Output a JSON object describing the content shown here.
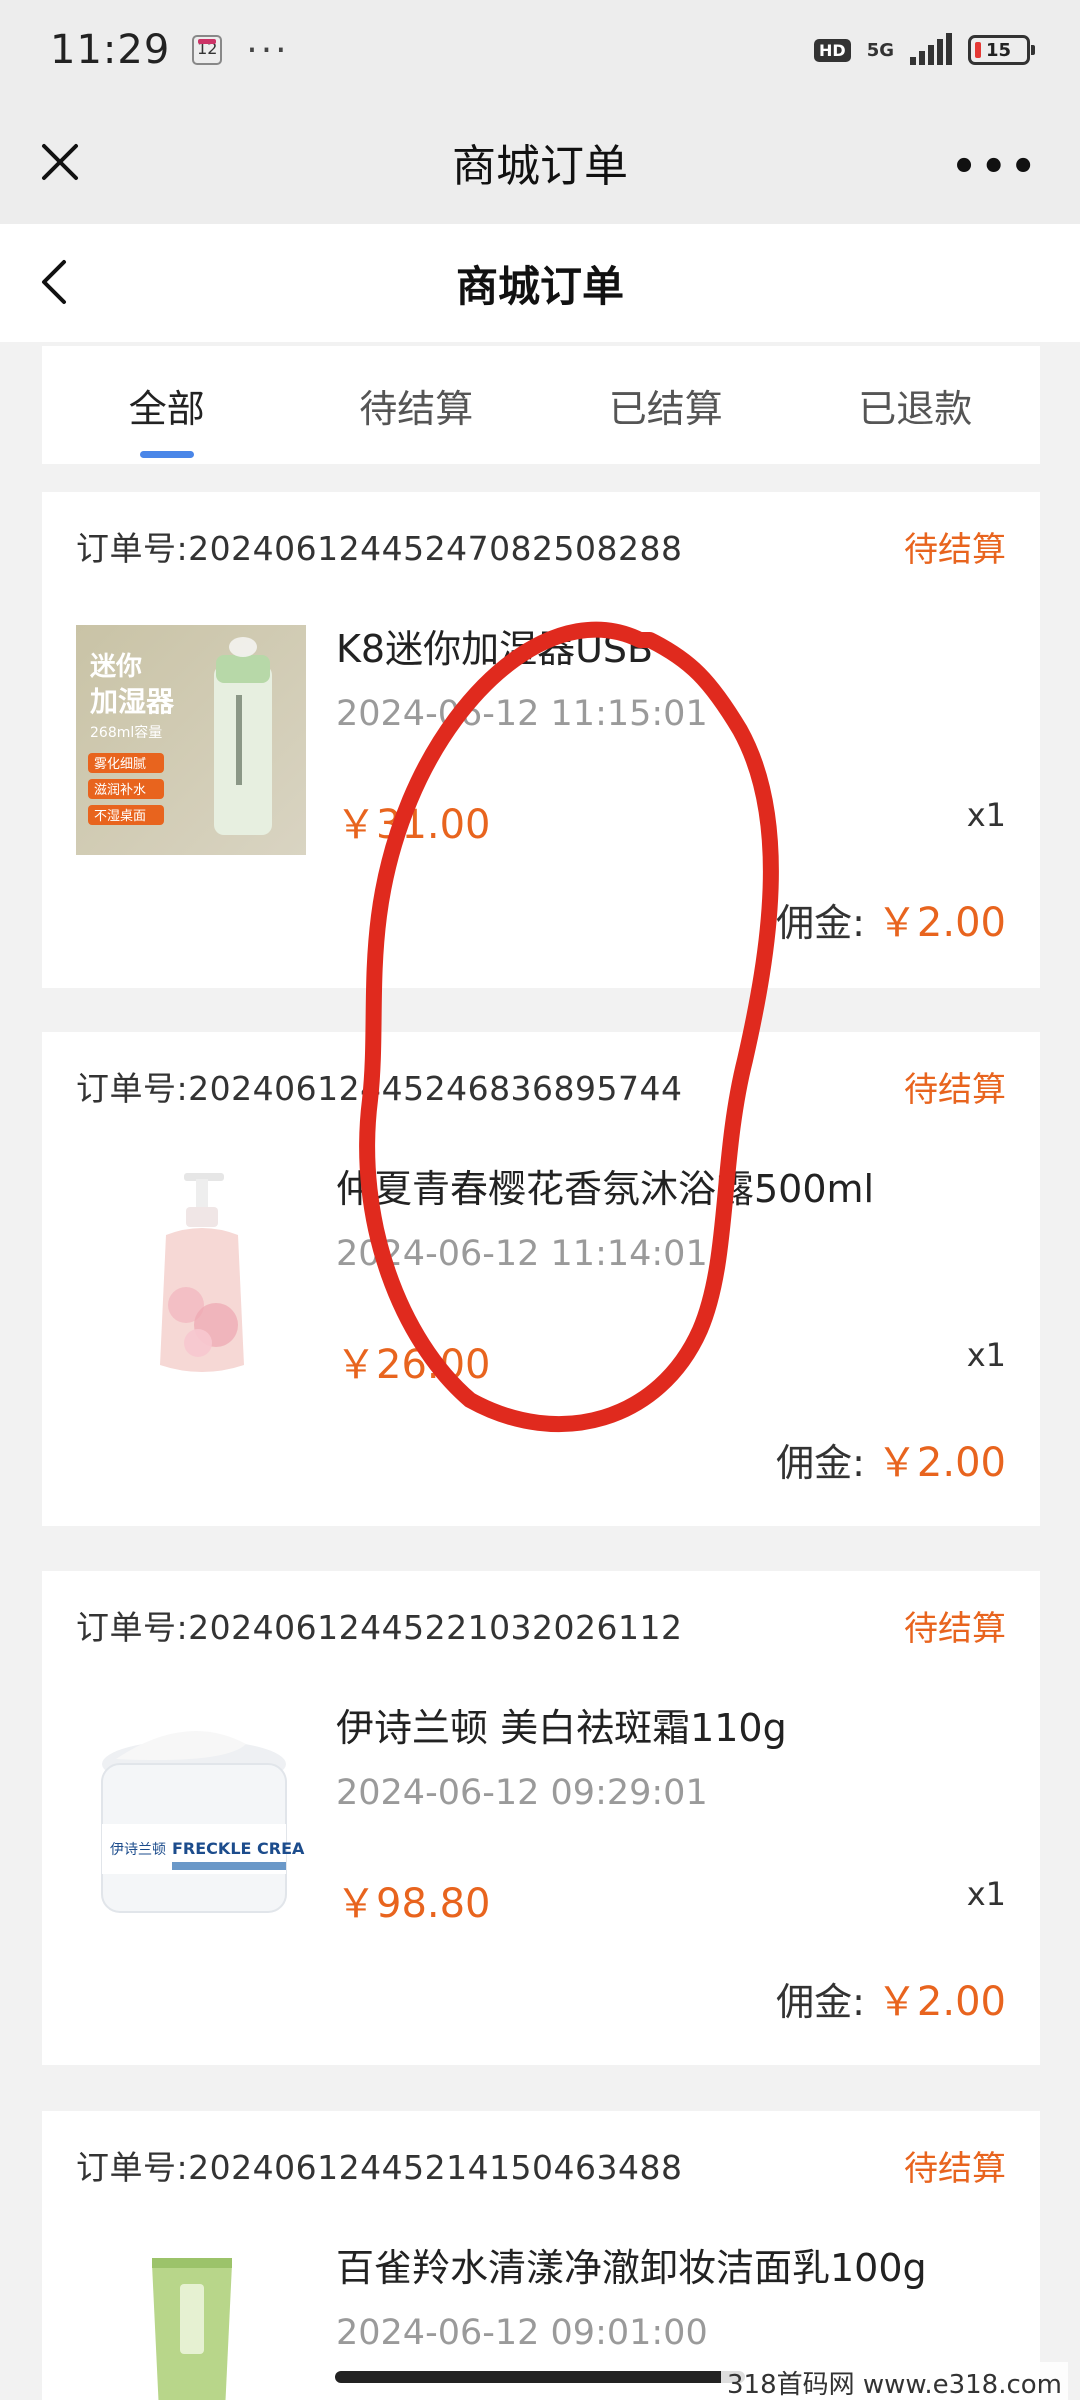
{
  "status_bar": {
    "time": "11:29",
    "calendar_day": "12",
    "more": "···",
    "hd": "HD",
    "network": "5G",
    "battery": "15",
    "battery_color": "#e53935"
  },
  "wechat_bar": {
    "title": "商城订单",
    "more": "•••",
    "close_icon": "close-icon"
  },
  "page_header": {
    "title": "商城订单",
    "back_icon": "chevron-left-icon"
  },
  "tabs": [
    {
      "label": "全部",
      "active": true
    },
    {
      "label": "待结算",
      "active": false
    },
    {
      "label": "已结算",
      "active": false
    },
    {
      "label": "已退款",
      "active": false
    }
  ],
  "accent_color": "#e8641e",
  "tab_indicator_color": "#4a86e8",
  "orders": [
    {
      "order_label": "订单号:",
      "order_no": "2024061244524708250 8288",
      "status": "待结算",
      "product_name": "K8迷你加湿器USB",
      "date": "2024-06-12 11:15:01",
      "price": "￥31.00",
      "qty": "x1",
      "commission_label": "佣金:",
      "commission": "￥2.00",
      "thumb_text": [
        "迷你",
        "加湿器",
        "268ml容量",
        "雾化细腻",
        "滋润补水",
        "不湿桌面"
      ]
    },
    {
      "order_label": "订单号:",
      "order_no": "20240612445246836895744",
      "status": "待结算",
      "product_name": "仲夏青春樱花香氛沐浴露500ml",
      "date": "2024-06-12 11:14:01",
      "price": "￥26.00",
      "qty": "x1",
      "commission_label": "佣金:",
      "commission": "￥2.00"
    },
    {
      "order_label": "订单号:",
      "order_no": "20240612445221032026112",
      "status": "待结算",
      "product_name": "伊诗兰顿 美白祛斑霜110g",
      "date": "2024-06-12 09:29:01",
      "price": "￥98.80",
      "qty": "x1",
      "commission_label": "佣金:",
      "commission": "￥2.00",
      "thumb_text": [
        "伊诗兰顿",
        "FRECKLE CREA"
      ]
    },
    {
      "order_label": "订单号:",
      "order_no": "20240612445214150463488",
      "status": "待结算",
      "product_name": "百雀羚水清漾净澈卸妆洁面乳100g",
      "date": "2024-06-12 09:01:00"
    }
  ],
  "watermark": "318首码网  www.e318.com"
}
